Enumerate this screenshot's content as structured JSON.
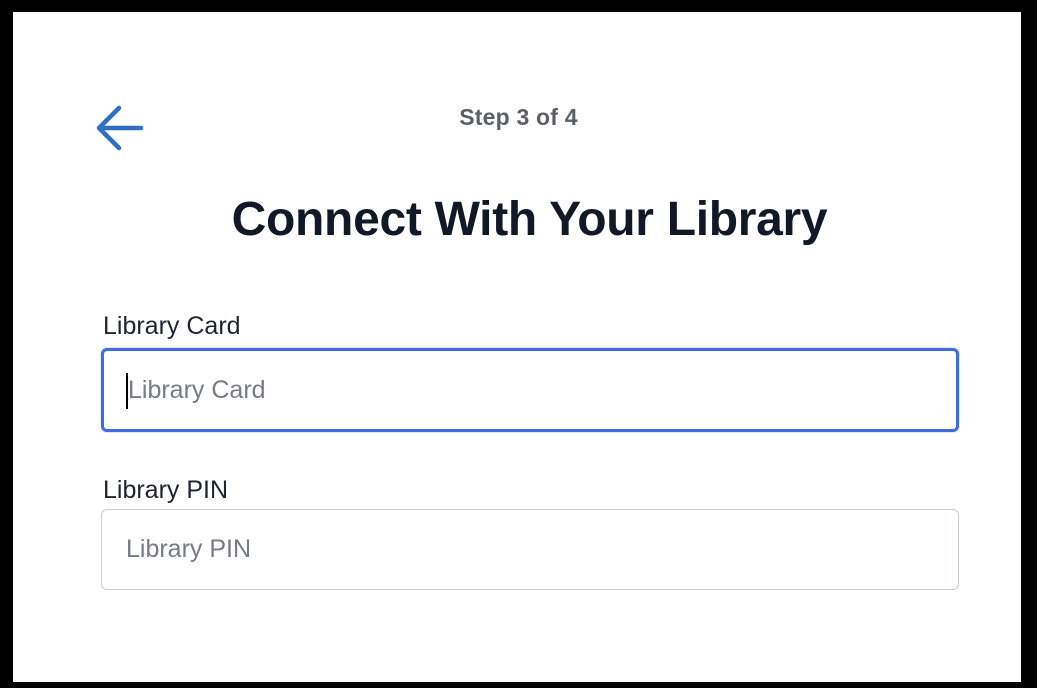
{
  "header": {
    "back_icon": "arrow-left-icon",
    "step_text": "Step 3 of 4",
    "accent_color": "#2f6fc6"
  },
  "main": {
    "title": "Connect With Your Library"
  },
  "form": {
    "library_card": {
      "label": "Library Card",
      "placeholder": "Library Card",
      "value": ""
    },
    "library_pin": {
      "label": "Library PIN",
      "placeholder": "Library PIN",
      "value": ""
    }
  }
}
